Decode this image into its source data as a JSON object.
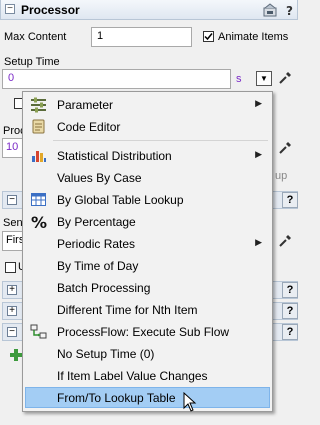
{
  "panel": {
    "title": "Processor",
    "max_content_label": "Max Content",
    "max_content_value": "1",
    "animate_items_label": "Animate Items",
    "animate_items_checked": true,
    "setup_time_label": "Setup Time",
    "setup_time_value": "0",
    "setup_time_unit": "s",
    "partial_proc_label": "Proc",
    "partial_value": "10",
    "partial_right": "up",
    "partial_sen_label": "Sen",
    "partial_firs_value": "Firs",
    "partial_u_label": "U"
  },
  "menu": {
    "items": [
      {
        "label": "Parameter",
        "icon": "parameter-icon",
        "submenu": true
      },
      {
        "label": "Code Editor",
        "icon": "code-editor-icon",
        "submenu": false
      },
      {
        "label": "Statistical Distribution",
        "icon": "statistical-distribution-icon",
        "submenu": true
      },
      {
        "label": "Values By Case",
        "icon": "",
        "submenu": false
      },
      {
        "label": "By Global Table Lookup",
        "icon": "table-icon",
        "submenu": false
      },
      {
        "label": "By Percentage",
        "icon": "percent-icon",
        "submenu": false
      },
      {
        "label": "Periodic Rates",
        "icon": "",
        "submenu": true
      },
      {
        "label": "By Time of Day",
        "icon": "",
        "submenu": false
      },
      {
        "label": "Batch Processing",
        "icon": "",
        "submenu": false
      },
      {
        "label": "Different Time for Nth Item",
        "icon": "",
        "submenu": false
      },
      {
        "label": "ProcessFlow: Execute Sub Flow",
        "icon": "processflow-icon",
        "submenu": false
      },
      {
        "label": "No Setup Time (0)",
        "icon": "",
        "submenu": false
      },
      {
        "label": "If Item Label Value Changes",
        "icon": "",
        "submenu": false
      },
      {
        "label": "From/To Lookup Table",
        "icon": "",
        "submenu": false,
        "highlighted": true
      }
    ]
  },
  "colors": {
    "highlight": "#a3cdf4",
    "value_purple": "#7b2ac7"
  }
}
